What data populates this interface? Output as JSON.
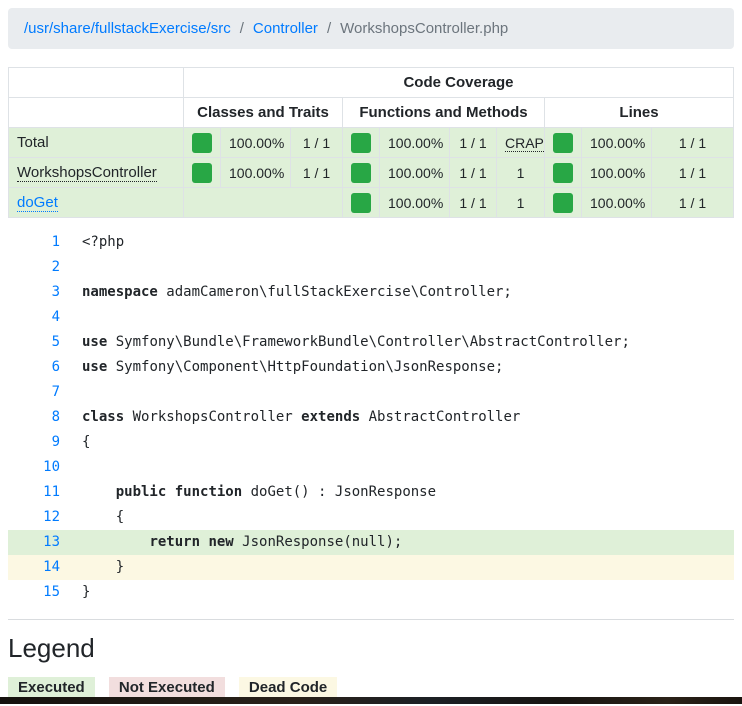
{
  "breadcrumb": {
    "separator": "/",
    "items": [
      {
        "label": "/usr/share/fullstackExercise/src",
        "type": "link"
      },
      {
        "label": "Controller",
        "type": "link"
      },
      {
        "label": "WorkshopsController.php",
        "type": "active"
      }
    ]
  },
  "coverage": {
    "title": "Code Coverage",
    "groups": {
      "classes": "Classes and Traits",
      "functions": "Functions and Methods",
      "lines": "Lines"
    },
    "rows": [
      {
        "name": "Total",
        "classes": {
          "pct": "100.00%",
          "ratio": "1 / 1"
        },
        "functions": {
          "pct": "100.00%",
          "ratio": "1 / 1",
          "crap": "CRAP"
        },
        "lines": {
          "pct": "100.00%",
          "ratio": "1 / 1"
        }
      },
      {
        "name": "WorkshopsController",
        "classes": {
          "pct": "100.00%",
          "ratio": "1 / 1"
        },
        "functions": {
          "pct": "100.00%",
          "ratio": "1 / 1",
          "crap": "1"
        },
        "lines": {
          "pct": "100.00%",
          "ratio": "1 / 1"
        }
      },
      {
        "name": "doGet",
        "classes": null,
        "functions": {
          "pct": "100.00%",
          "ratio": "1 / 1",
          "crap": "1"
        },
        "lines": {
          "pct": "100.00%",
          "ratio": "1 / 1"
        }
      }
    ]
  },
  "code": {
    "lines": [
      {
        "n": 1,
        "parts": [
          {
            "t": "<?php"
          }
        ]
      },
      {
        "n": 2,
        "parts": []
      },
      {
        "n": 3,
        "parts": [
          {
            "t": "namespace",
            "k": true
          },
          {
            "t": " adamCameron\\fullStackExercise\\Controller;"
          }
        ]
      },
      {
        "n": 4,
        "parts": []
      },
      {
        "n": 5,
        "parts": [
          {
            "t": "use",
            "k": true
          },
          {
            "t": " Symfony\\Bundle\\FrameworkBundle\\Controller\\AbstractController;"
          }
        ]
      },
      {
        "n": 6,
        "parts": [
          {
            "t": "use",
            "k": true
          },
          {
            "t": " Symfony\\Component\\HttpFoundation\\JsonResponse;"
          }
        ]
      },
      {
        "n": 7,
        "parts": []
      },
      {
        "n": 8,
        "parts": [
          {
            "t": "class",
            "k": true
          },
          {
            "t": " WorkshopsController "
          },
          {
            "t": "extends",
            "k": true
          },
          {
            "t": " AbstractController"
          }
        ]
      },
      {
        "n": 9,
        "parts": [
          {
            "t": "{"
          }
        ]
      },
      {
        "n": 10,
        "parts": []
      },
      {
        "n": 11,
        "parts": [
          {
            "t": "    "
          },
          {
            "t": "public",
            "k": true
          },
          {
            "t": " "
          },
          {
            "t": "function",
            "k": true
          },
          {
            "t": " doGet() : JsonResponse"
          }
        ]
      },
      {
        "n": 12,
        "parts": [
          {
            "t": "    {"
          }
        ]
      },
      {
        "n": 13,
        "parts": [
          {
            "t": "        "
          },
          {
            "t": "return",
            "k": true
          },
          {
            "t": " "
          },
          {
            "t": "new",
            "k": true
          },
          {
            "t": " JsonResponse(null);"
          }
        ],
        "state": "executed"
      },
      {
        "n": 14,
        "parts": [
          {
            "t": "    }"
          }
        ],
        "state": "dead"
      },
      {
        "n": 15,
        "parts": [
          {
            "t": "}"
          }
        ]
      }
    ]
  },
  "legend": {
    "title": "Legend",
    "items": [
      {
        "label": "Executed",
        "state": "executed"
      },
      {
        "label": "Not Executed",
        "state": "not-executed"
      },
      {
        "label": "Dead Code",
        "state": "dead"
      }
    ]
  },
  "colors": {
    "executed_bg": "#dff0d8",
    "not_executed_bg": "#f2dede",
    "dead_code_bg": "#fcf8e3",
    "coverage_bar": "#28a745",
    "link": "#007bff",
    "breadcrumb_bg": "#e9ecef",
    "muted_text": "#6c757d",
    "table_border": "#dee2e6"
  }
}
